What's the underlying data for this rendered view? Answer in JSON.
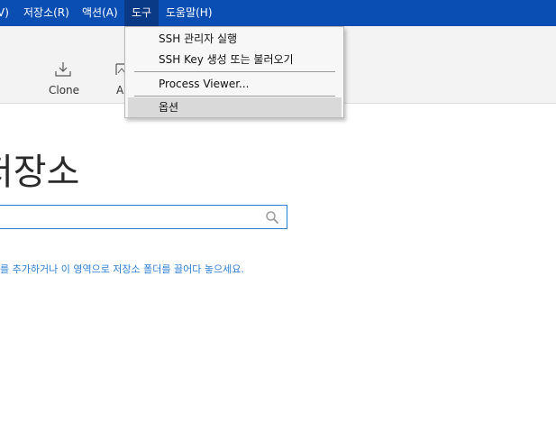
{
  "menubar": {
    "items": [
      {
        "label": "V)"
      },
      {
        "label": "저장소(R)"
      },
      {
        "label": "액션(A)"
      },
      {
        "label": "도구"
      },
      {
        "label": "도움말(H)"
      }
    ]
  },
  "toolbar": {
    "clone_label": "Clone",
    "add_label_partial": "A"
  },
  "main": {
    "title_partial": "저장소",
    "search": {
      "value": ""
    },
    "hint_partial": "를 추가하거나 이 영역으로 저장소 폴더를 끌어다 놓으세요."
  },
  "tools_menu": {
    "items": [
      {
        "label": "SSH 관리자 실행"
      },
      {
        "label": "SSH Key 생성 또는 불러오기"
      },
      {
        "label": "Process Viewer..."
      },
      {
        "label": "옵션"
      }
    ]
  },
  "colors": {
    "menubar_bg": "#0a4eb3",
    "accent": "#2b7fd6"
  }
}
